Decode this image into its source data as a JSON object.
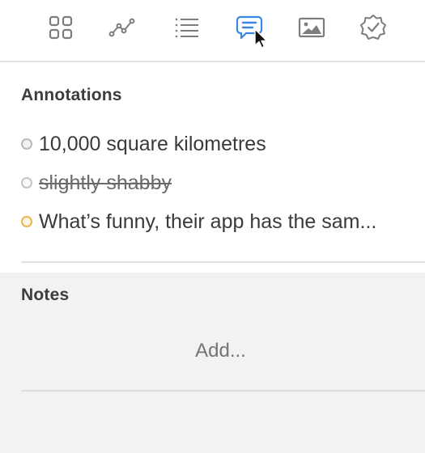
{
  "toolbar": {
    "buttons": [
      {
        "icon": "grid-icon",
        "label": "Overview",
        "active": false
      },
      {
        "icon": "chart-line-icon",
        "label": "Statistics",
        "active": false
      },
      {
        "icon": "list-icon",
        "label": "Outline",
        "active": false
      },
      {
        "icon": "comment-icon",
        "label": "Annotations",
        "active": true
      },
      {
        "icon": "image-icon",
        "label": "Images",
        "active": false
      },
      {
        "icon": "check-badge-icon",
        "label": "Goals",
        "active": false
      }
    ],
    "colors": {
      "icon": "#7d7d7f",
      "active": "#3a86e0"
    }
  },
  "annotations": {
    "title": "Annotations",
    "items": [
      {
        "text": "10,000 square kilometres",
        "status": "gray",
        "struck": false
      },
      {
        "text": "slightly shabby",
        "status": "light",
        "struck": true
      },
      {
        "text": "What’s funny, their app has the sam...",
        "status": "gold",
        "struck": false
      }
    ]
  },
  "notes": {
    "title": "Notes",
    "add_label": "Add..."
  }
}
